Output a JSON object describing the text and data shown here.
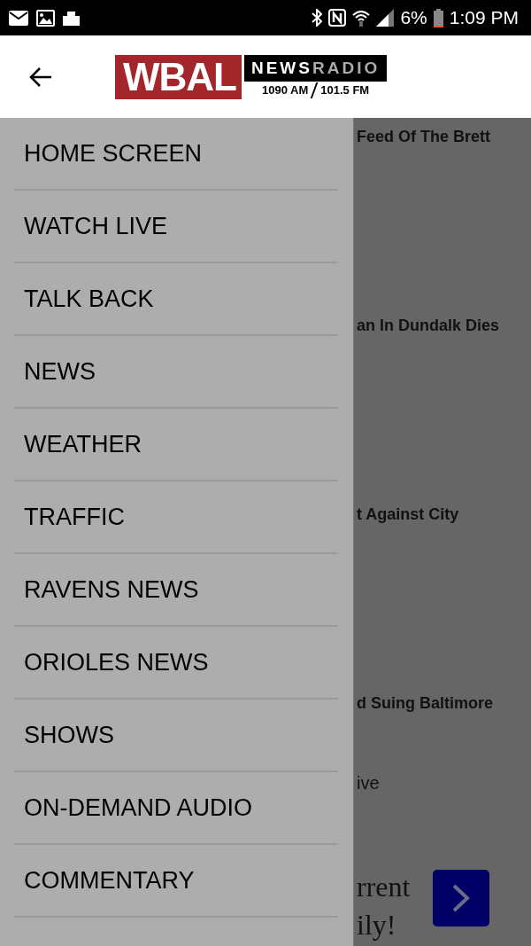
{
  "status_bar": {
    "battery": "6%",
    "time": "1:09 PM"
  },
  "header": {
    "logo": {
      "name": "WBAL",
      "tag_primary": "NEWS",
      "tag_secondary": "RADIO",
      "frequencies": [
        "1090 AM",
        "101.5 FM"
      ]
    }
  },
  "drawer": {
    "items": [
      {
        "label": "HOME SCREEN"
      },
      {
        "label": "WATCH LIVE"
      },
      {
        "label": "TALK BACK"
      },
      {
        "label": "NEWS"
      },
      {
        "label": "WEATHER"
      },
      {
        "label": "TRAFFIC"
      },
      {
        "label": "RAVENS NEWS"
      },
      {
        "label": "ORIOLES NEWS"
      },
      {
        "label": "SHOWS"
      },
      {
        "label": "ON-DEMAND AUDIO"
      },
      {
        "label": "COMMENTARY"
      }
    ]
  },
  "content": {
    "items": [
      {
        "kind": "headline",
        "text": "Feed Of The Brett"
      },
      {
        "kind": "headline",
        "text": "an In Dundalk Dies"
      },
      {
        "kind": "headline",
        "text": "t Against City"
      },
      {
        "kind": "headline",
        "text": "d Suing Baltimore"
      },
      {
        "kind": "text",
        "text": "ive"
      },
      {
        "kind": "promo",
        "lines": [
          "rrent",
          "ily!"
        ]
      }
    ]
  }
}
